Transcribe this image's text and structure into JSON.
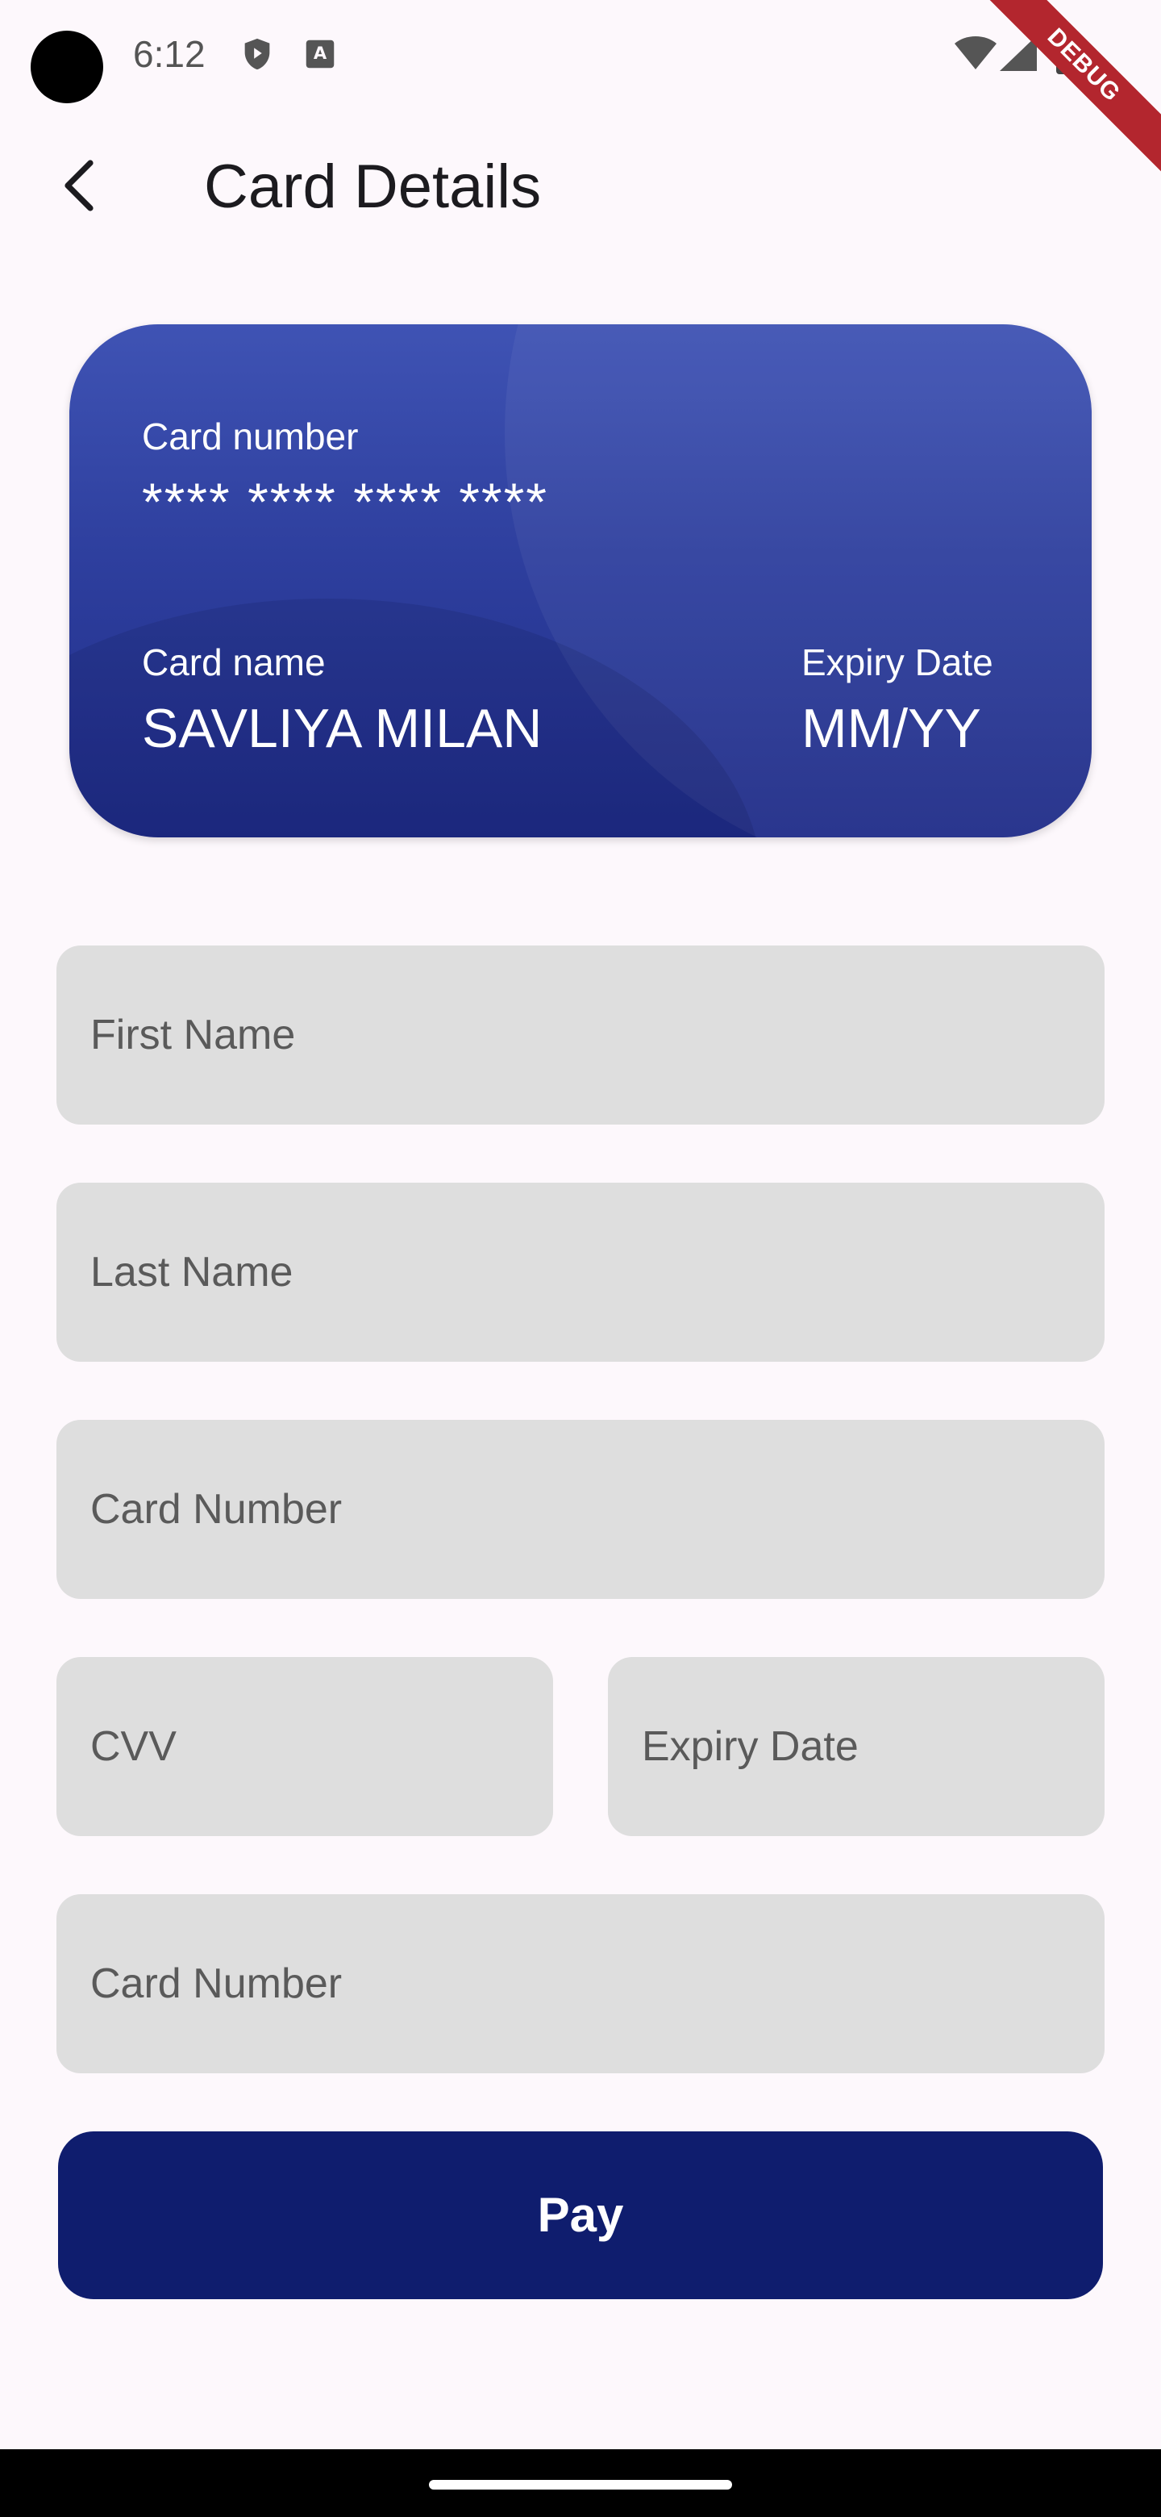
{
  "status_bar": {
    "time": "6:12",
    "debug_ribbon": "DEBUG",
    "icons": [
      "camera-cutout",
      "play-protect-icon",
      "keyboard-a-icon",
      "wifi-icon",
      "cell-signal-icon",
      "battery-icon"
    ]
  },
  "app_bar": {
    "back_icon": "arrow-back-icon",
    "title": "Card Details"
  },
  "card": {
    "number_label": "Card number",
    "number_value": "**** **** **** ****",
    "name_label": "Card name",
    "name_value": "SAVLIYA MILAN",
    "expiry_label": "Expiry Date",
    "expiry_value": "MM/YY",
    "colors": {
      "top": "#3f53b4",
      "bottom": "#1f2c88"
    }
  },
  "form": {
    "first_name_placeholder": "First Name",
    "last_name_placeholder": "Last Name",
    "card_number_placeholder": "Card Number",
    "cvv_placeholder": "CVV",
    "expiry_placeholder": "Expiry Date",
    "card_number2_placeholder": "Card Number",
    "field_color": "#dedede"
  },
  "pay_button": {
    "label": "Pay",
    "color": "#0f1d6e"
  }
}
